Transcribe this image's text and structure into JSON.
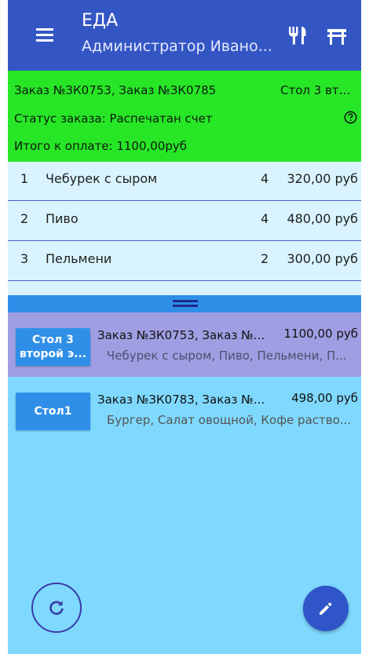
{
  "appbar": {
    "title": "ЕДА",
    "subtitle": "Администратор Ивано...",
    "icons": {
      "menu": "menu-icon",
      "dishes": "utensils-icon",
      "tables": "table-icon"
    }
  },
  "order_header": {
    "orders": "Заказ №ЗК0753, Заказ №ЗК0785",
    "table": "Стол 3 вто...",
    "status": "Статус заказа: Распечатан счет",
    "total": "Итого к оплате: 1100,00руб",
    "help_icon": "help-icon"
  },
  "order_lines": [
    {
      "n": "1",
      "name": "Чебурек с сыром",
      "qty": "4",
      "price": "320,00 руб"
    },
    {
      "n": "2",
      "name": "Пиво",
      "qty": "4",
      "price": "480,00 руб"
    },
    {
      "n": "3",
      "name": "Пельмени",
      "qty": "2",
      "price": "300,00 руб"
    }
  ],
  "orders_list": [
    {
      "table_line1": "Стол 3",
      "table_line2": "второй э...",
      "orders": "Заказ №ЗК0753, Заказ №...",
      "sum": "1100,00 руб",
      "items": "Чебурек с сыром, Пиво, Пельмени, П..."
    },
    {
      "table_line1": "Стол1",
      "orders": "Заказ №ЗК0783, Заказ №...",
      "sum": "498,00 руб",
      "items": "Бургер, Салат овощной, Кофе раство..."
    }
  ],
  "fabs": {
    "refresh": "refresh-icon",
    "edit": "pencil-icon"
  },
  "colors": {
    "appbar": "#3456c4",
    "header_green": "#27e626",
    "lines_bg": "#d9f4ff",
    "list_bg": "#7fd9ff",
    "selected_card": "#a09ee2",
    "table_button": "#2f8fe8",
    "fab_edit": "#2f55c8"
  }
}
